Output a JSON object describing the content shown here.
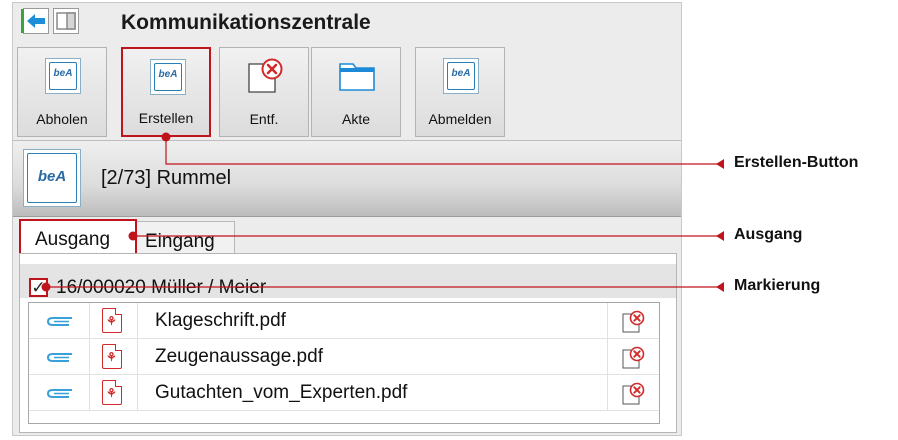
{
  "window": {
    "title": "Kommunikationszentrale"
  },
  "toolbar": {
    "buttons": [
      {
        "label": "Abholen",
        "icon": "bea-icon"
      },
      {
        "label": "Erstellen",
        "icon": "bea-icon",
        "highlighted": true
      },
      {
        "label": "Entf.",
        "icon": "delete-document-icon"
      },
      {
        "label": "Akte",
        "icon": "folder-icon"
      },
      {
        "label": "Abmelden",
        "icon": "bea-icon"
      }
    ]
  },
  "account": {
    "logo_text": "beA",
    "label": "[2/73] Rummel"
  },
  "tabs": [
    {
      "label": "Ausgang",
      "active": true
    },
    {
      "label": "Eingang",
      "active": false
    }
  ],
  "group": {
    "checked": true,
    "check_glyph": "✓",
    "label": "16/000020  Müller / Meier"
  },
  "files": [
    {
      "name": "Klageschrift.pdf"
    },
    {
      "name": "Zeugenaussage.pdf"
    },
    {
      "name": "Gutachten_vom_Experten.pdf"
    }
  ],
  "callouts": [
    {
      "label": "Erstellen-Button"
    },
    {
      "label": "Ausgang"
    },
    {
      "label": "Markierung"
    }
  ],
  "colors": {
    "highlight": "#c0141c",
    "accent_blue": "#2a7fb6",
    "pdf_red": "#d12a2a"
  }
}
